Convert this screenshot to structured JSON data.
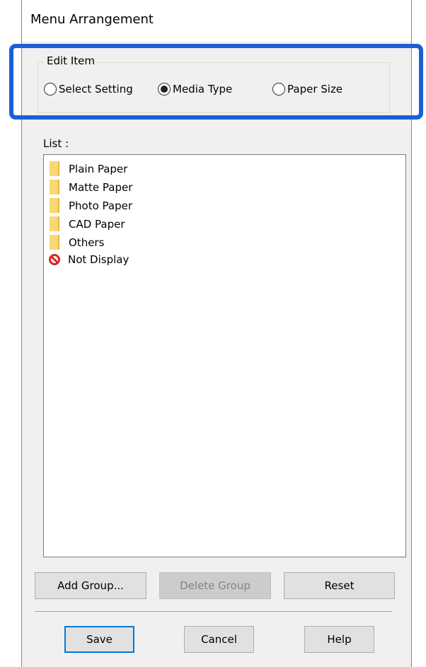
{
  "dialog": {
    "title": "Menu Arrangement"
  },
  "edit_item": {
    "legend": "Edit Item",
    "options": [
      {
        "label": "Select Setting",
        "selected": false
      },
      {
        "label": "Media Type",
        "selected": true
      },
      {
        "label": "Paper Size",
        "selected": false
      }
    ]
  },
  "list": {
    "label": "List :",
    "items": [
      {
        "label": "Plain Paper",
        "icon": "folder-icon"
      },
      {
        "label": "Matte Paper",
        "icon": "folder-icon"
      },
      {
        "label": "Photo Paper",
        "icon": "folder-icon"
      },
      {
        "label": "CAD Paper",
        "icon": "folder-icon"
      },
      {
        "label": "Others",
        "icon": "folder-icon"
      },
      {
        "label": "Not Display",
        "icon": "no-entry-icon"
      }
    ]
  },
  "buttons": {
    "add_group": "Add Group...",
    "delete_group": "Delete Group",
    "reset": "Reset",
    "save": "Save",
    "cancel": "Cancel",
    "help": "Help"
  },
  "colors": {
    "highlight": "#1a5fd6",
    "folder": "#f8d775",
    "no_entry": "#d9262a"
  }
}
